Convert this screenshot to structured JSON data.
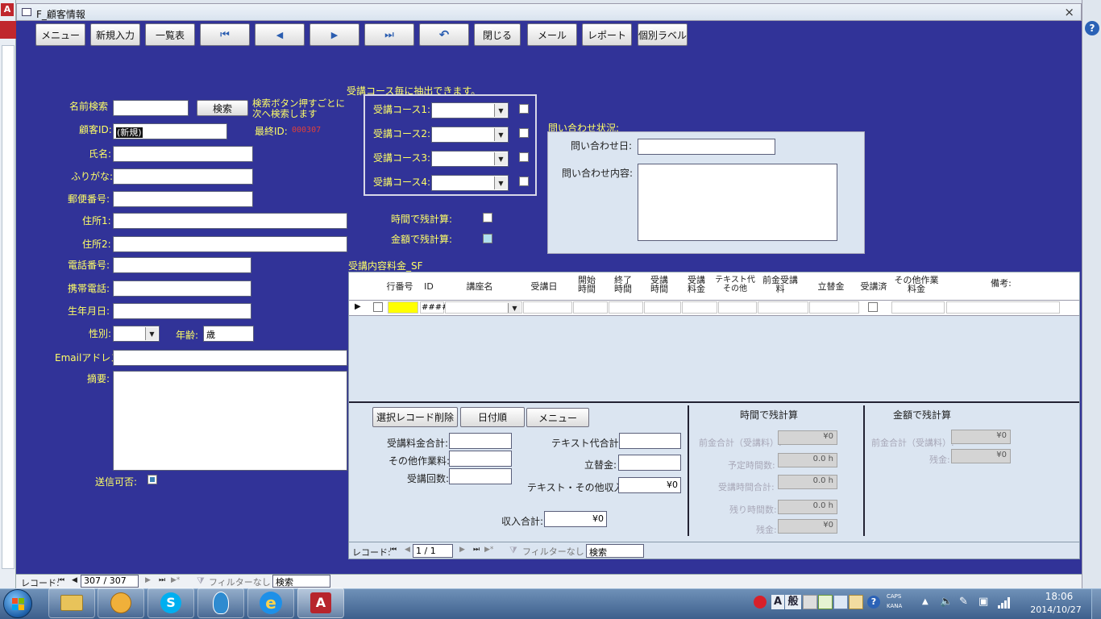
{
  "window": {
    "title": "F_顧客情報",
    "close": "×"
  },
  "toolbar": {
    "menu": "メニュー",
    "new_entry": "新規入力",
    "list": "一覧表",
    "first": "⏮",
    "prev": "◀",
    "next": "▶",
    "last": "⏭",
    "undo": "↶",
    "close": "閉じる",
    "mail": "メール",
    "report": "レポート",
    "label": "個別ラベル"
  },
  "form": {
    "name_search_label": "名前検索",
    "search_button": "検索",
    "search_hint": "検索ボタン押すごとに次へ検索します",
    "customer_id_label": "顧客ID:",
    "customer_id_value": "(新規)",
    "last_id_label": "最終ID:",
    "last_id_value": "000307",
    "name_label": "氏名:",
    "furigana_label": "ふりがな:",
    "postal_label": "郵便番号:",
    "address1_label": "住所1:",
    "address2_label": "住所2:",
    "phone_label": "電話番号:",
    "mobile_label": "携帯電話:",
    "birthday_label": "生年月日:",
    "gender_label": "性別:",
    "age_label": "年齢:",
    "age_value": "歳",
    "email_label": "Emailアドレス:",
    "memo_label": "摘要:",
    "send_ok_label": "送信可否:"
  },
  "courses": {
    "header": "受講コース毎に抽出できます。",
    "items": [
      "受講コース1:",
      "受講コース2:",
      "受講コース3:",
      "受講コース4:"
    ]
  },
  "calc_flags": {
    "time_label": "時間で残計算:",
    "amount_label": "金額で残計算:"
  },
  "inquiry": {
    "header": "問い合わせ状況:",
    "date_label": "問い合わせ日:",
    "content_label": "問い合わせ内容:"
  },
  "subform": {
    "title": "受講内容料金_SF",
    "columns": {
      "row_no": "行番号",
      "id": "ID",
      "course": "講座名",
      "date": "受講日",
      "start": "開始時間",
      "end": "終了時間",
      "duration": "受講時間",
      "fee": "受講料金",
      "text": "テキスト代その他",
      "advance": "前金受講料",
      "advance_pay": "立替金",
      "done": "受講済",
      "other": "その他作業料金",
      "note": "備考:"
    },
    "row_id_value": "####",
    "buttons": {
      "delete": "選択レコード削除",
      "date_order": "日付順",
      "menu": "メニュー"
    },
    "totals": {
      "fee_total": "受講料金合計:",
      "other_fee": "その他作業料:",
      "count": "受講回数:",
      "text_total": "テキスト代合計:",
      "advance_pay": "立替金:",
      "text_other_income": "テキスト・その他収入:",
      "text_other_income_value": "¥0",
      "income_total": "収入合計:",
      "income_total_value": "¥0"
    },
    "time_calc": {
      "title": "時間で残計算",
      "advance": "前金合計（受講料）:",
      "advance_value": "¥0",
      "planned": "予定時間数:",
      "planned_value": "0.0 h",
      "used": "受講時間合計:",
      "used_value": "0.0 h",
      "remaining": "残り時間数:",
      "remaining_value": "0.0 h",
      "balance": "残金:",
      "balance_value": "¥0"
    },
    "amount_calc": {
      "title": "金額で残計算",
      "advance": "前金合計（受講料）:",
      "advance_value": "¥0",
      "balance": "残金:",
      "balance_value": "¥0"
    },
    "nav": {
      "label": "レコード:",
      "position": "1 / 1",
      "filter": "フィルターなし",
      "search": "検索"
    }
  },
  "main_nav": {
    "label": "レコード:",
    "position": "307 / 307",
    "filter": "フィルターなし",
    "search": "検索"
  },
  "taskbar": {
    "ime_a": "A",
    "ime_mode": "般",
    "caps": "CAPS",
    "kana": "KANA",
    "time": "18:06",
    "date": "2014/10/27"
  }
}
